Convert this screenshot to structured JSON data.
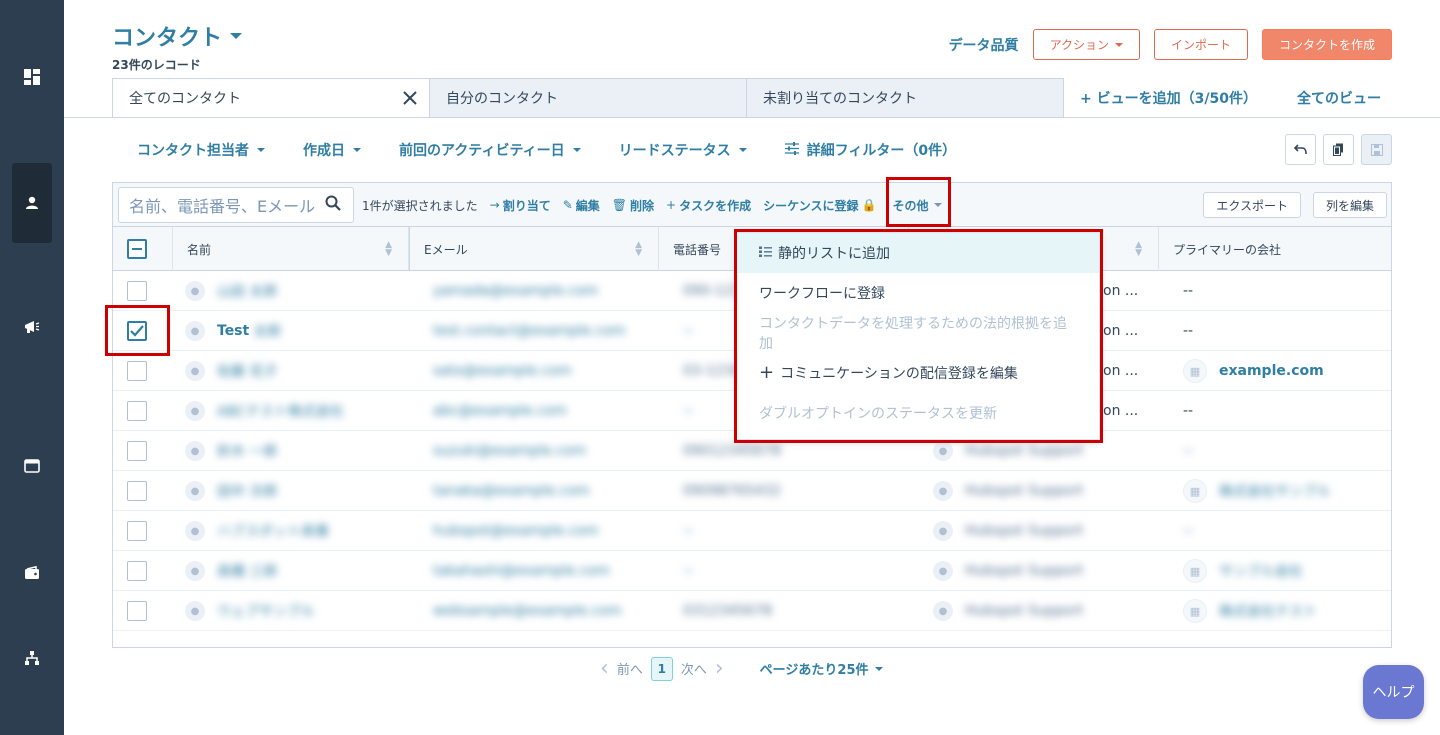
{
  "header": {
    "title": "コンタクト",
    "record_count": "23件のレコード",
    "data_quality": "データ品質",
    "actions_label": "アクション",
    "import_label": "インポート",
    "create_label": "コンタクトを作成"
  },
  "tabs": [
    {
      "label": "全てのコンタクト"
    },
    {
      "label": "自分のコンタクト"
    },
    {
      "label": "未割り当てのコンタクト"
    }
  ],
  "tab_links": {
    "add_view": "+ ビューを追加（3/50件）",
    "all_views": "全てのビュー"
  },
  "filters": [
    {
      "label": "コンタクト担当者"
    },
    {
      "label": "作成日"
    },
    {
      "label": "前回のアクティビティー日"
    },
    {
      "label": "リードステータス"
    }
  ],
  "advanced_filter": "詳細フィルター（0件）",
  "toolbar": {
    "search_placeholder": "名前、電話番号、Eメール",
    "selected_text": "1件が選択されました",
    "assign": "割り当て",
    "edit": "編集",
    "delete": "削除",
    "create_task": "タスクを作成",
    "enroll_sequence": "シーケンスに登録",
    "more": "その他",
    "export": "エクスポート",
    "edit_columns": "列を編集"
  },
  "columns": {
    "name": "名前",
    "email": "Eメール",
    "phone": "電話番号",
    "company": "プライマリーの会社"
  },
  "rows": [
    {
      "name": "山田 太郎",
      "email": "yamada@example.com",
      "phone": "090-1234",
      "owner": "on ...",
      "company": "--"
    },
    {
      "name": "Test",
      "name_suffix": "太郎",
      "email": "test.contact@example.com",
      "phone": "--",
      "owner": "on ...",
      "company": "--"
    },
    {
      "name": "佐藤 花子",
      "email": "sato@example.com",
      "phone": "03-1234",
      "owner": "on ...",
      "company": "example.com"
    },
    {
      "name": "ABCテスト株式会社",
      "email": "abc@example.com",
      "phone": "--",
      "owner": "on ...",
      "company": "--"
    },
    {
      "name": "鈴木 一郎",
      "email": "suzuki@example.com",
      "phone": "09012345678",
      "owner": "Hubspot Support",
      "company": "--"
    },
    {
      "name": "田中 次郎",
      "email": "tanaka@example.com",
      "phone": "09098765432",
      "owner": "Hubspot Support",
      "company": "株式会社サンプル"
    },
    {
      "name": "ハブスポット商事",
      "email": "hubspot@example.com",
      "phone": "--",
      "owner": "Hubspot Support",
      "company": "--"
    },
    {
      "name": "高橋 三郎",
      "email": "takahashi@example.com",
      "phone": "--",
      "owner": "Hubspot Support",
      "company": "サンプル会社"
    },
    {
      "name": "ウェブサンプル",
      "email": "websample@example.com",
      "phone": "0312345678",
      "owner": "Hubspot Support",
      "company": "株式会社テスト"
    }
  ],
  "dropdown": [
    {
      "label": "静的リストに追加",
      "icon": "list-icon",
      "state": "hover"
    },
    {
      "label": "ワークフローに登録",
      "icon": "",
      "state": "normal"
    },
    {
      "label": "コンタクトデータを処理するための法的根拠を追加",
      "icon": "",
      "state": "disabled"
    },
    {
      "label": "コミュニケーションの配信登録を編集",
      "icon": "plus-icon",
      "state": "normal"
    },
    {
      "label": "ダブルオプトインのステータスを更新",
      "icon": "",
      "state": "disabled"
    }
  ],
  "pagination": {
    "prev": "前へ",
    "current": "1",
    "next": "次へ",
    "per_page": "ページあたり25件"
  },
  "help": "ヘルプ",
  "colors": {
    "sidebar": "#2d3e50",
    "link": "#2f7ea3",
    "primary": "#f0866a",
    "highlight": "#cc0000"
  }
}
